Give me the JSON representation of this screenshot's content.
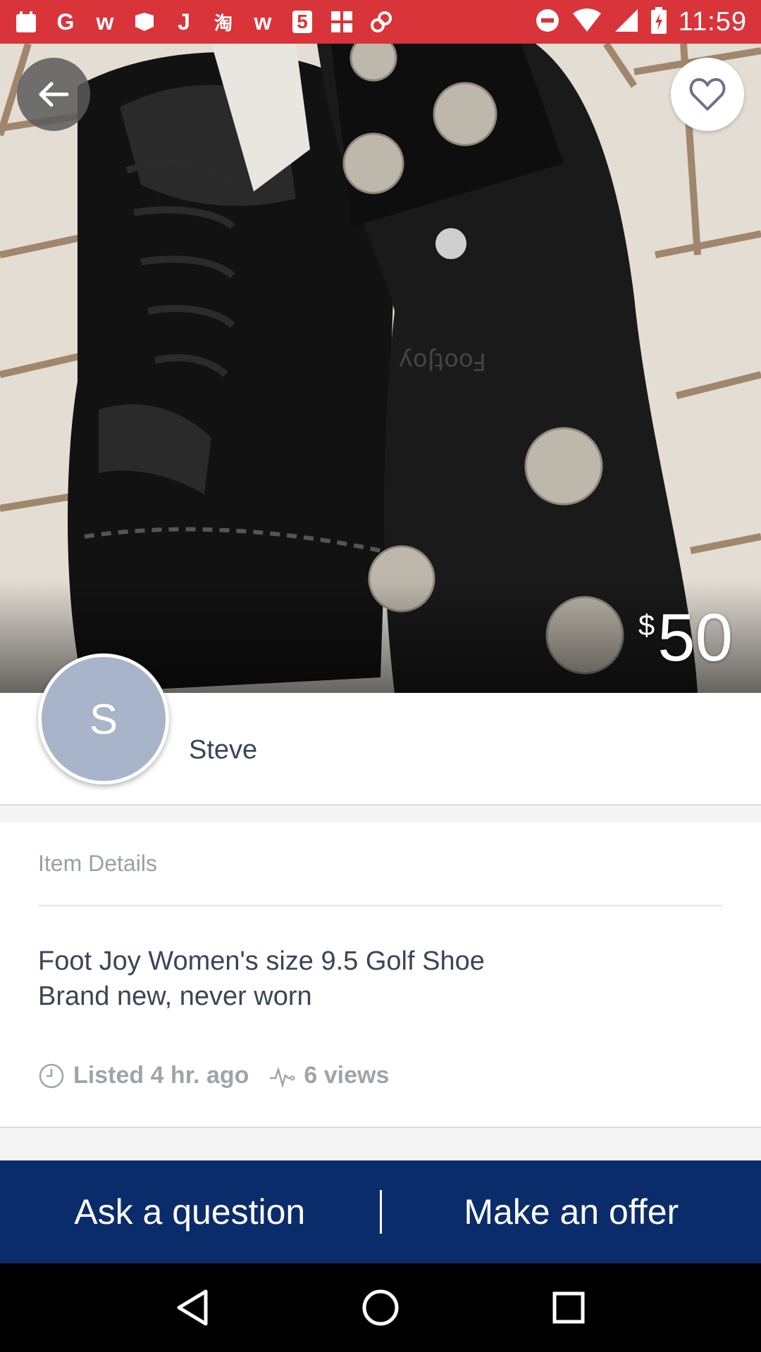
{
  "status_bar": {
    "time": "11:59",
    "icons": [
      "G",
      "w",
      "J",
      "淘",
      "w",
      "5"
    ],
    "bg_color": "#d8343a"
  },
  "listing": {
    "price_currency": "$",
    "price_amount": "50",
    "image_count": 3,
    "active_image": 1
  },
  "seller": {
    "initial": "S",
    "name": "Steve"
  },
  "details": {
    "header": "Item Details",
    "line1": "Foot Joy Women's size 9.5 Golf Shoe",
    "line2": "Brand new, never worn",
    "listed": "Listed 4 hr. ago",
    "views": "6 views"
  },
  "actions": {
    "ask": "Ask a question",
    "offer": "Make an offer",
    "bar_color": "#0b2c6b"
  }
}
